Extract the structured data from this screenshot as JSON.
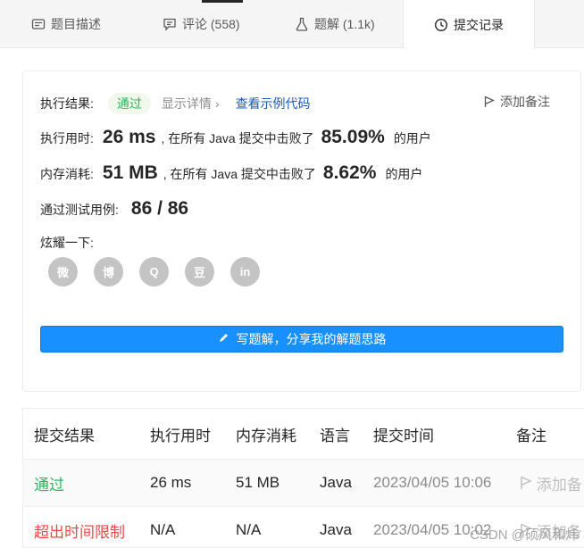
{
  "tabs": [
    {
      "label": "题目描述",
      "icon": "description-icon"
    },
    {
      "label": "评论 (558)",
      "icon": "comment-icon"
    },
    {
      "label": "题解 (1.1k)",
      "icon": "flask-icon"
    },
    {
      "label": "提交记录",
      "icon": "clock-icon"
    }
  ],
  "result": {
    "label": "执行结果:",
    "status": "通过",
    "detail": "显示详情",
    "example_link": "查看示例代码",
    "add_note": "添加备注"
  },
  "runtime": {
    "label": "执行用时:",
    "value": "26 ms",
    "mid": ", 在所有 Java 提交中击败了",
    "percent": "85.09%",
    "suffix": "的用户"
  },
  "memory": {
    "label": "内存消耗:",
    "value": "51 MB",
    "mid": ", 在所有 Java 提交中击败了",
    "percent": "8.62%",
    "suffix": "的用户"
  },
  "tests": {
    "label": "通过测试用例:",
    "value": "86 / 86"
  },
  "share": {
    "label": "炫耀一下:",
    "icons": [
      "wechat-icon",
      "weibo-icon",
      "qq-icon",
      "douban-icon",
      "linkedin-icon"
    ],
    "glyphs": [
      "微",
      "博",
      "Q",
      "豆",
      "in"
    ]
  },
  "write_button": "写题解，分享我的解题思路",
  "table": {
    "headers": [
      "提交结果",
      "执行用时",
      "内存消耗",
      "语言",
      "提交时间",
      "备注"
    ],
    "rows": [
      {
        "result": "通过",
        "time": "26 ms",
        "memory": "51 MB",
        "lang": "Java",
        "submitted": "2023/04/05 10:06",
        "note": "添加备"
      },
      {
        "result": "超出时间限制",
        "time": "N/A",
        "memory": "N/A",
        "lang": "Java",
        "submitted": "2023/04/05 10:02",
        "note": "添加备"
      }
    ]
  },
  "watermark": "CSDN @硕风和炜",
  "colors": {
    "accent": "#1890ff",
    "success": "#2db55d",
    "error": "#ef4743"
  }
}
